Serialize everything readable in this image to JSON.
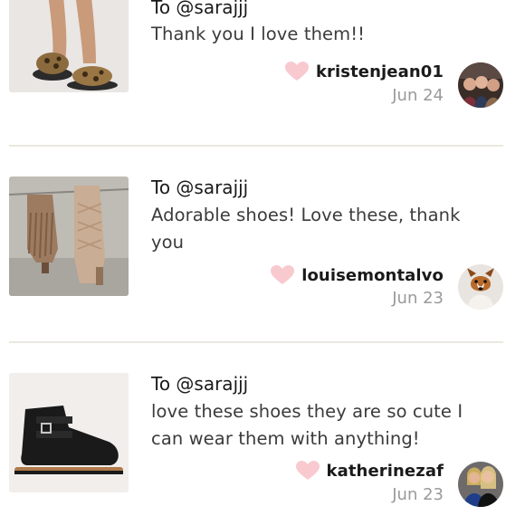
{
  "reviews": [
    {
      "to": "To @sarajjj",
      "message": "Thank you I love them!!",
      "username": "kristenjean01",
      "date": "Jun 24",
      "product_icon": "slide-sandal-leopard-icon",
      "avatar_icon": "group-photo-avatar"
    },
    {
      "to": "To @sarajjj",
      "message": "Adorable shoes! Love these, thank you",
      "username": "louisemontalvo",
      "date": "Jun 23",
      "product_icon": "fringe-lace-up-heels-icon",
      "avatar_icon": "dog-photo-avatar"
    },
    {
      "to": "To @sarajjj",
      "message": "love these shoes they are so cute I can wear them with anything!",
      "username": "katherinezaf",
      "date": "Jun 23",
      "product_icon": "black-strap-sandal-icon",
      "avatar_icon": "two-people-photo-avatar"
    }
  ],
  "colors": {
    "heart": "#f8c9cf",
    "divider": "#ebe8e1",
    "date_gray": "#9a9a9a"
  }
}
